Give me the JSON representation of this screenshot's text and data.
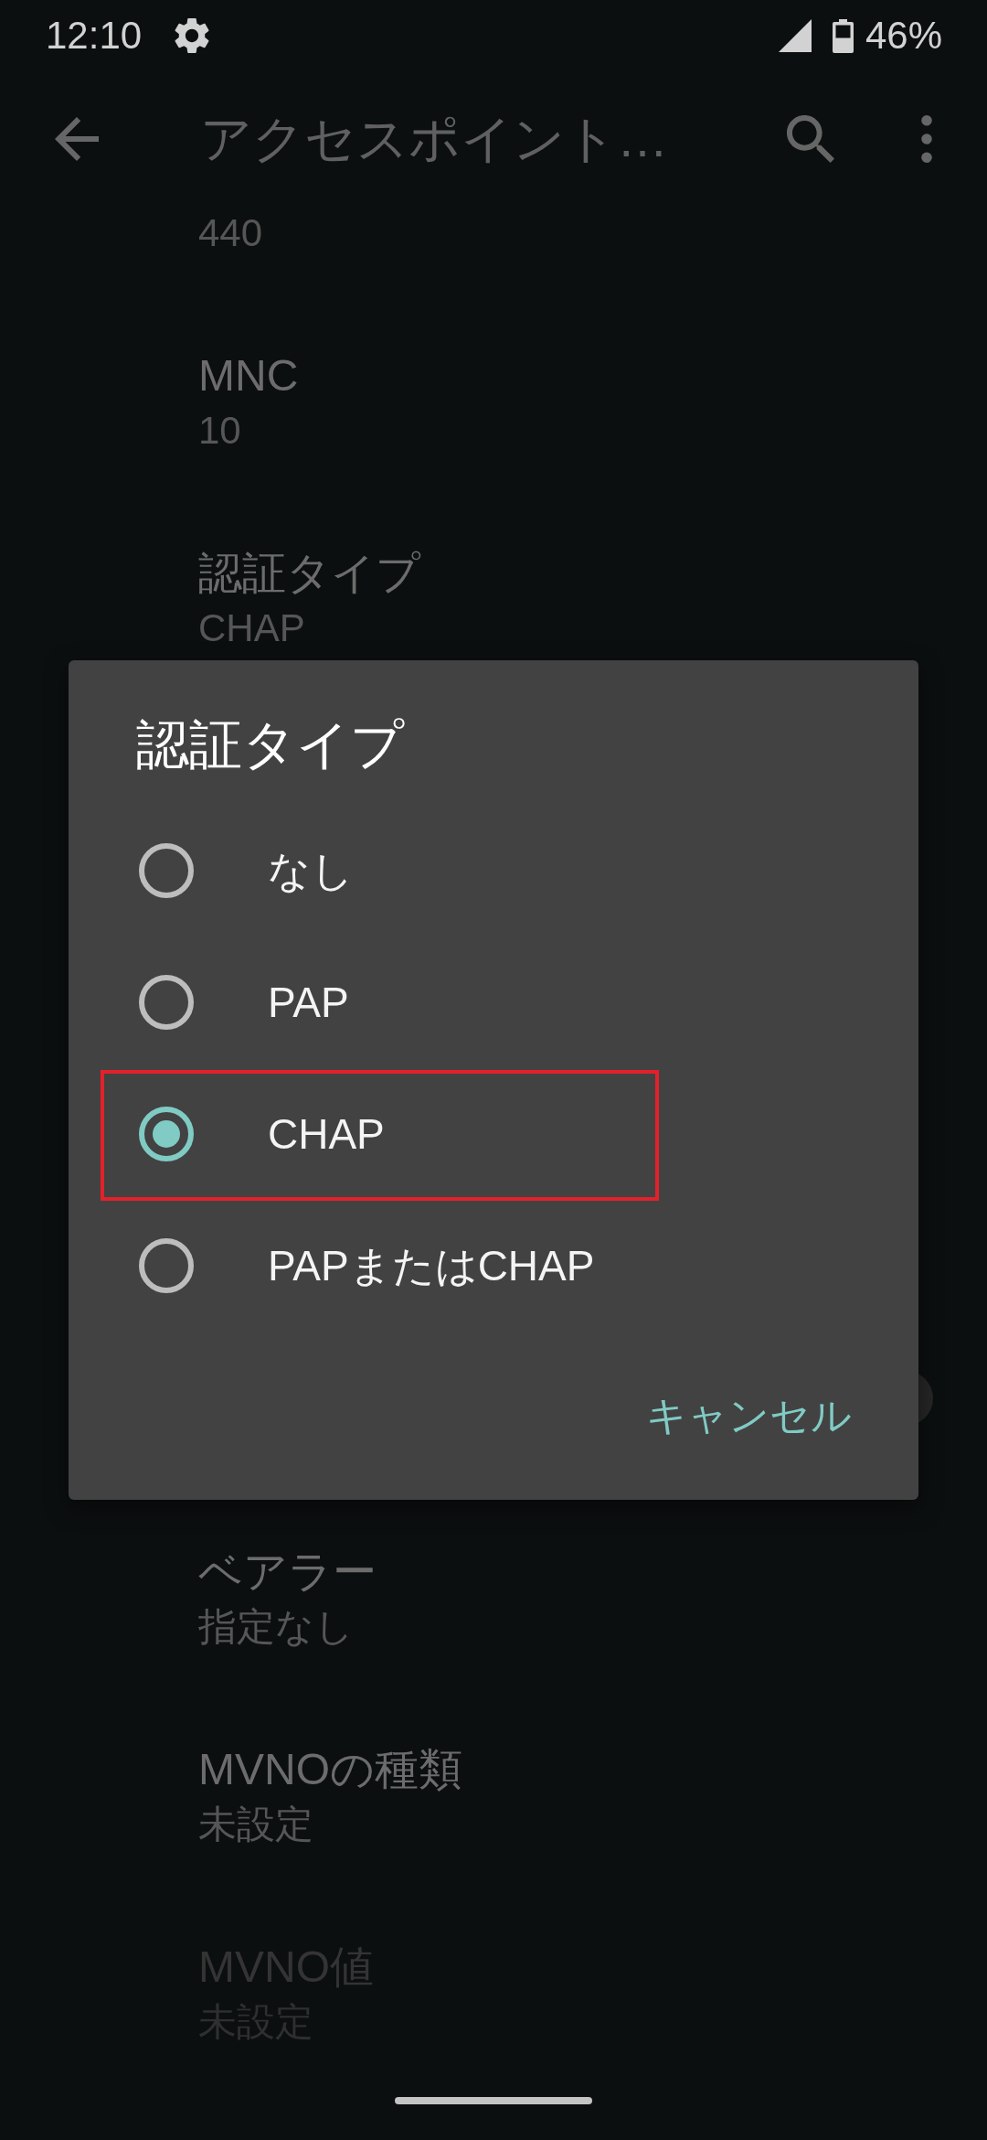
{
  "status_bar": {
    "time": "12:10",
    "battery": "46%"
  },
  "app_bar": {
    "title": "アクセスポイント…"
  },
  "settings": {
    "above_dialog": [
      {
        "summary": "440",
        "disabled": false
      },
      {
        "title": "MNC",
        "summary": "10",
        "disabled": false
      },
      {
        "title": "認証タイプ",
        "summary": "CHAP",
        "disabled": false
      }
    ],
    "below_dialog": [
      {
        "title": "ベアラー",
        "summary": "指定なし",
        "disabled": false
      },
      {
        "title": "MVNOの種類",
        "summary": "未設定",
        "disabled": false
      },
      {
        "title": "MVNO値",
        "summary": "未設定",
        "disabled": true
      }
    ]
  },
  "dialog": {
    "title": "認証タイプ",
    "options": [
      {
        "label": "なし",
        "selected": false,
        "highlighted": false
      },
      {
        "label": "PAP",
        "selected": false,
        "highlighted": false
      },
      {
        "label": "CHAP",
        "selected": true,
        "highlighted": true
      },
      {
        "label": "PAPまたはCHAP",
        "selected": false,
        "highlighted": false
      }
    ],
    "buttons": [
      "キャンセル"
    ]
  }
}
